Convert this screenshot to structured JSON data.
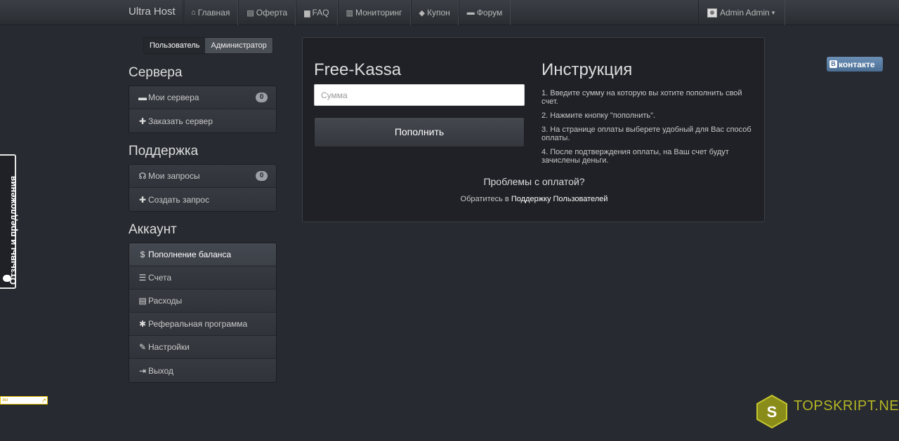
{
  "navbar": {
    "brand": "Ultra Host",
    "items": [
      {
        "label": "Главная",
        "icon": "home-icon",
        "glyph": "⌂"
      },
      {
        "label": "Оферта",
        "icon": "list-icon",
        "glyph": "▤"
      },
      {
        "label": "FAQ",
        "icon": "book-icon",
        "glyph": "▆"
      },
      {
        "label": "Мониторинг",
        "icon": "bar-chart-icon",
        "glyph": "▥"
      },
      {
        "label": "Купон",
        "icon": "tag-icon",
        "glyph": "◆"
      },
      {
        "label": "Форум",
        "icon": "comment-icon",
        "glyph": "▬"
      }
    ],
    "user": "Admin Admin"
  },
  "roles": {
    "user": "Пользователь",
    "admin": "Администратор"
  },
  "sidebar": {
    "servers": {
      "title": "Сервера",
      "items": [
        {
          "label": "Мои сервера",
          "icon": "hdd-icon",
          "glyph": "▬",
          "badge": "0"
        },
        {
          "label": "Заказать сервер",
          "icon": "plus-icon",
          "glyph": "✚"
        }
      ]
    },
    "support": {
      "title": "Поддержка",
      "items": [
        {
          "label": "Мои запросы",
          "icon": "headphones-icon",
          "glyph": "☊",
          "badge": "0"
        },
        {
          "label": "Создать запрос",
          "icon": "plus-icon",
          "glyph": "✚"
        }
      ]
    },
    "account": {
      "title": "Аккаунт",
      "items": [
        {
          "label": "Пополнение баланса",
          "icon": "dollar-icon",
          "glyph": "$"
        },
        {
          "label": "Счета",
          "icon": "list-icon",
          "glyph": "☰"
        },
        {
          "label": "Расходы",
          "icon": "table-icon",
          "glyph": "▤"
        },
        {
          "label": "Реферальная программа",
          "icon": "asterisk-icon",
          "glyph": "✱"
        },
        {
          "label": "Настройки",
          "icon": "wrench-icon",
          "glyph": "✎"
        },
        {
          "label": "Выход",
          "icon": "logout-icon",
          "glyph": "⇥"
        }
      ]
    }
  },
  "payment": {
    "title": "Free-Kassa",
    "amount_placeholder": "Сумма",
    "amount_value": "",
    "submit_label": "Пополнить"
  },
  "instructions": {
    "title": "Инструкция",
    "steps": [
      "1. Введите сумму на которую вы хотите пополнить свой счет.",
      "2. Нажмите кнопку \"пополнить\".",
      "3. На странице оплаты выберете удобный для Вас способ оплаты.",
      "4. После подтверждения оплаты, на Ваш счет будут зачислены деньги."
    ]
  },
  "help": {
    "question": "Проблемы с оплатой?",
    "prefix": "Обратитесь в",
    "link": "Поддержку Пользователей"
  },
  "vk": {
    "label": "контакте",
    "logo": "В"
  },
  "feedback": {
    "label": "Отзывы и предложения"
  },
  "strip": {
    "text": "зы"
  },
  "watermark": {
    "text": "TOPSKRIPT.NET",
    "logo_letter": "S"
  },
  "colors": {
    "accent": "#4a6d93",
    "watermark": "#b4b624",
    "background": "#272a30"
  }
}
